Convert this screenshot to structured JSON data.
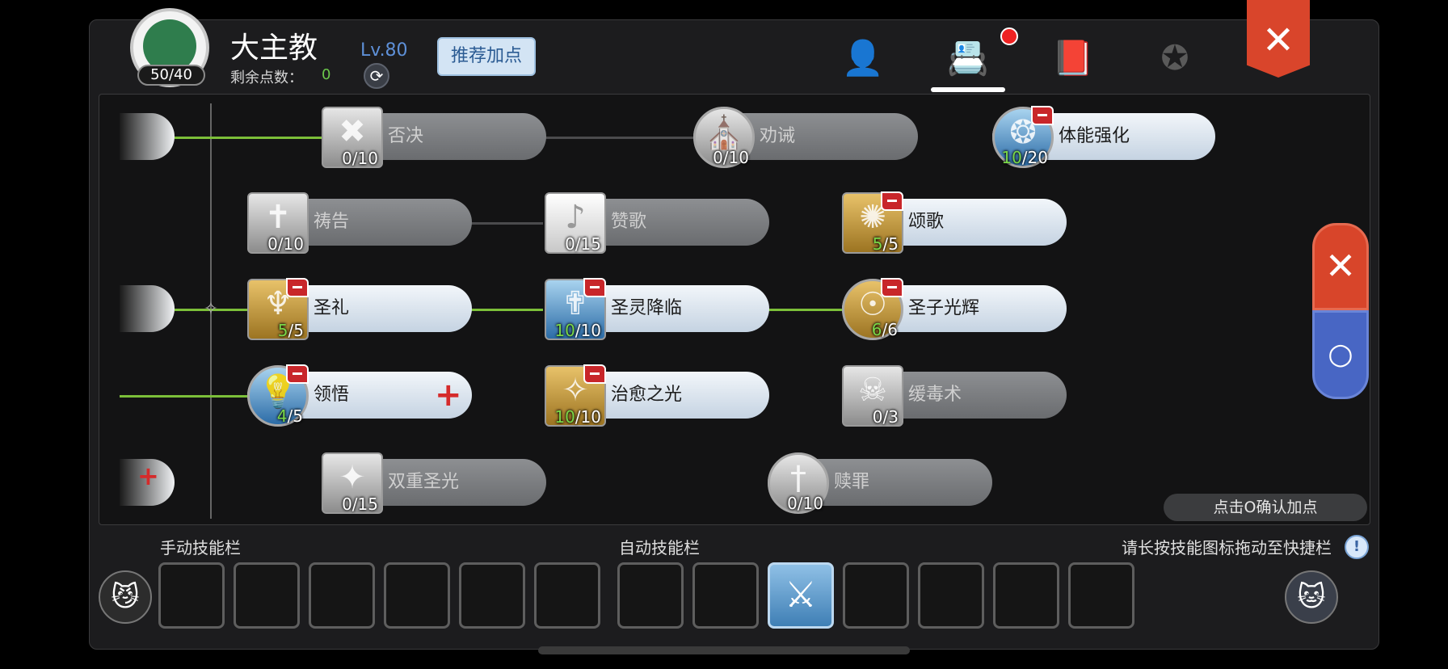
{
  "header": {
    "class_name": "大主教",
    "points_badge": "50/40",
    "remaining_label": "剩余点数：",
    "remaining_value": "0",
    "level": "Lv.80",
    "recommend_button": "推荐加点",
    "tabs": [
      {
        "icon": "person-star-icon",
        "glyph": "👤"
      },
      {
        "icon": "skill-book-contact-icon",
        "glyph": "📇",
        "active": true,
        "notification": true
      },
      {
        "icon": "book-icon",
        "glyph": "📕"
      },
      {
        "icon": "winged-star-badge-icon",
        "glyph": "✪"
      }
    ],
    "close_glyph": "✕"
  },
  "skills": [
    {
      "name": "否决",
      "cur": "0",
      "max": "10",
      "state": "locked",
      "icon": "cross-circle-icon",
      "glyph": "✖"
    },
    {
      "name": "劝诫",
      "cur": "0",
      "max": "10",
      "state": "locked",
      "icon": "kneeling-figure-icon",
      "glyph": "⛪"
    },
    {
      "name": "体能强化",
      "cur": "10",
      "max": "20",
      "state": "learned",
      "icon": "blue-aura-icon",
      "glyph": "❂"
    },
    {
      "name": "祷告",
      "cur": "0",
      "max": "10",
      "state": "locked",
      "icon": "praying-robe-icon",
      "glyph": "✝"
    },
    {
      "name": "赞歌",
      "cur": "0",
      "max": "15",
      "state": "locked",
      "icon": "music-note-icon",
      "glyph": "♪"
    },
    {
      "name": "颂歌",
      "cur": "5",
      "max": "5",
      "state": "learned",
      "icon": "golden-chant-icon",
      "glyph": "✺"
    },
    {
      "name": "圣礼",
      "cur": "5",
      "max": "5",
      "state": "learned",
      "icon": "raised-arms-icon",
      "glyph": "♆"
    },
    {
      "name": "圣灵降临",
      "cur": "10",
      "max": "10",
      "state": "learned",
      "icon": "angel-wings-icon",
      "glyph": "✟"
    },
    {
      "name": "圣子光辉",
      "cur": "6",
      "max": "6",
      "state": "learned",
      "icon": "golden-child-icon",
      "glyph": "☉"
    },
    {
      "name": "领悟",
      "cur": "4",
      "max": "5",
      "state": "learned",
      "icon": "lightbulb-icon",
      "glyph": "💡"
    },
    {
      "name": "治愈之光",
      "cur": "10",
      "max": "10",
      "state": "learned",
      "icon": "light-beam-icon",
      "glyph": "✧"
    },
    {
      "name": "缓毒术",
      "cur": "0",
      "max": "3",
      "state": "locked",
      "icon": "stop-skull-icon",
      "glyph": "☠"
    },
    {
      "name": "双重圣光",
      "cur": "0",
      "max": "15",
      "state": "locked",
      "icon": "sparkle-icon",
      "glyph": "✦"
    },
    {
      "name": "赎罪",
      "cur": "0",
      "max": "10",
      "state": "locked",
      "icon": "sword-icon",
      "glyph": "†"
    }
  ],
  "side": {
    "cancel_glyph": "✕",
    "confirm_glyph": "○"
  },
  "confirm_hint": "点击O确认加点",
  "bottom": {
    "manual_label": "手动技能栏",
    "auto_label": "自动技能栏",
    "drag_hint": "请长按技能图标拖动至快捷栏",
    "info_glyph": "!",
    "left_cat": "😼",
    "right_cat": "🐱",
    "slot_skill_glyph": "⚔"
  }
}
